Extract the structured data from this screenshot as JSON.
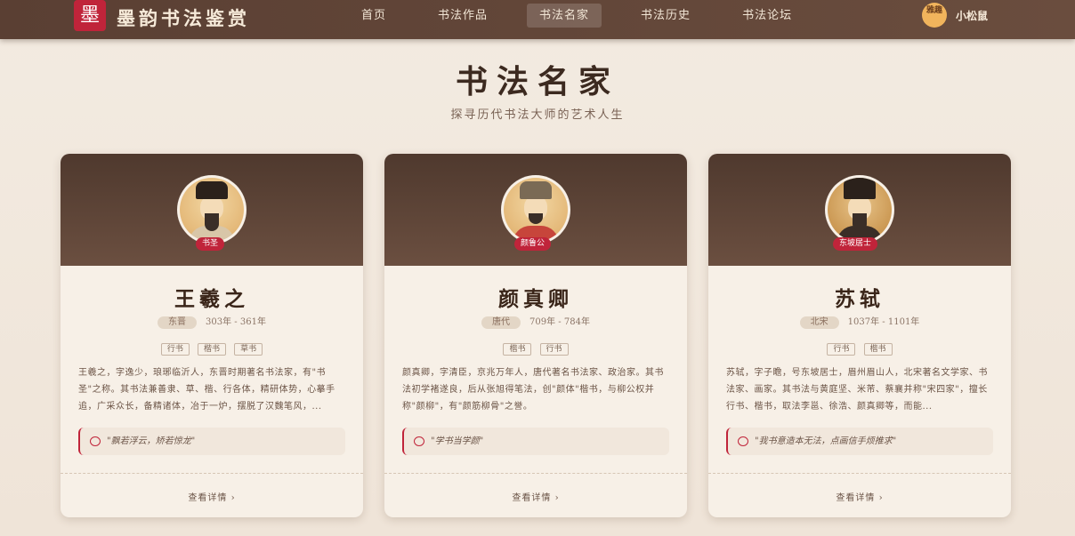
{
  "header": {
    "logo_char": "墨",
    "brand": "墨韵书法鉴赏",
    "nav": [
      {
        "label": "首页",
        "active": false
      },
      {
        "label": "书法作品",
        "active": false
      },
      {
        "label": "书法名家",
        "active": true
      },
      {
        "label": "书法历史",
        "active": false
      },
      {
        "label": "书法论坛",
        "active": false
      }
    ],
    "user": {
      "avatar_text": "雅趣",
      "name": "小松鼠"
    }
  },
  "page": {
    "title": "书法名家",
    "subtitle": "探寻历代书法大师的艺术人生"
  },
  "cards": [
    {
      "badge": "书圣",
      "name": "王羲之",
      "dynasty": "东晋",
      "years": "303年 - 361年",
      "tags": [
        "行书",
        "楷书",
        "草书"
      ],
      "description": "王羲之，字逸少，琅琊临沂人，东晋时期著名书法家，有\"书圣\"之称。其书法兼善隶、草、楷、行各体，精研体势，心摹手追，广采众长，备精诸体，冶于一炉，摆脱了汉魏笔风，...",
      "quote": "\"飘若浮云，矫若惊龙\"",
      "detail": "查看详情 ›"
    },
    {
      "badge": "颜鲁公",
      "name": "颜真卿",
      "dynasty": "唐代",
      "years": "709年 - 784年",
      "tags": [
        "楷书",
        "行书"
      ],
      "description": "颜真卿，字清臣，京兆万年人，唐代著名书法家、政治家。其书法初学褚遂良，后从张旭得笔法，创\"颜体\"楷书，与柳公权并称\"颜柳\"，有\"颜筋柳骨\"之誉。",
      "quote": "\"学书当学颜\"",
      "detail": "查看详情 ›"
    },
    {
      "badge": "东坡居士",
      "name": "苏轼",
      "dynasty": "北宋",
      "years": "1037年 - 1101年",
      "tags": [
        "行书",
        "楷书"
      ],
      "description": "苏轼，字子瞻，号东坡居士，眉州眉山人，北宋著名文学家、书法家、画家。其书法与黄庭坚、米芾、蔡襄并称\"宋四家\"，擅长行书、楷书，取法李邕、徐浩、颜真卿等，而能...",
      "quote": "\"我书意造本无法，点画信手烦推求\"",
      "detail": "查看详情 ›"
    }
  ]
}
